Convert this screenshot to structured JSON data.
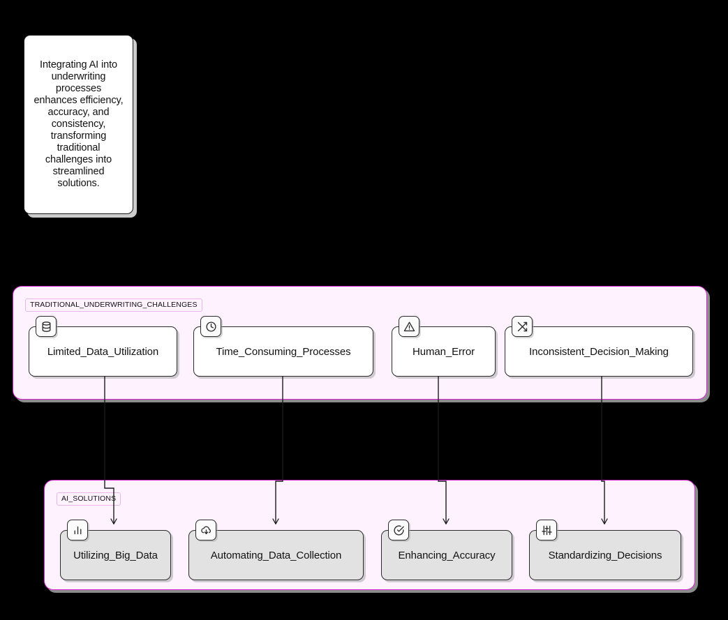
{
  "note": {
    "text": "Integrating AI into underwriting processes enhances efficiency, accuracy, and consistency, transforming traditional challenges into streamlined solutions."
  },
  "colors": {
    "canvas": "#000000",
    "subgraph_border": "#d426d4",
    "subgraph_fill": "#fdf2fd",
    "node_border": "#2b2b2b",
    "challenge_node_fill": "#ffffff",
    "solution_node_fill": "#e2e2e2",
    "edge": "#1a1a1a",
    "text": "#111111"
  },
  "subgraphs": [
    {
      "id": "traditional_underwriting_challenges",
      "label": "TRADITIONAL_UNDERWRITING_CHALLENGES",
      "nodes": [
        {
          "id": "limited_data_utilization",
          "label": "Limited_Data_Utilization",
          "icon": "database-icon"
        },
        {
          "id": "time_consuming_processes",
          "label": "Time_Consuming_Processes",
          "icon": "clock-icon"
        },
        {
          "id": "human_error",
          "label": "Human_Error",
          "icon": "warning-triangle-icon"
        },
        {
          "id": "inconsistent_decision_making",
          "label": "Inconsistent_Decision_Making",
          "icon": "shuffle-icon"
        }
      ]
    },
    {
      "id": "ai_solutions",
      "label": "AI_SOLUTIONS",
      "nodes": [
        {
          "id": "utilizing_big_data",
          "label": "Utilizing_Big_Data",
          "icon": "bar-chart-icon"
        },
        {
          "id": "automating_data_collection",
          "label": "Automating_Data_Collection",
          "icon": "cloud-download-icon"
        },
        {
          "id": "enhancing_accuracy",
          "label": "Enhancing_Accuracy",
          "icon": "check-circle-icon"
        },
        {
          "id": "standardizing_decisions",
          "label": "Standardizing_Decisions",
          "icon": "sliders-icon"
        }
      ]
    }
  ],
  "edges": [
    {
      "from": "limited_data_utilization",
      "to": "utilizing_big_data",
      "label": ""
    },
    {
      "from": "time_consuming_processes",
      "to": "automating_data_collection",
      "label": ""
    },
    {
      "from": "human_error",
      "to": "enhancing_accuracy",
      "label": ""
    },
    {
      "from": "inconsistent_decision_making",
      "to": "standardizing_decisions",
      "label": ""
    }
  ]
}
